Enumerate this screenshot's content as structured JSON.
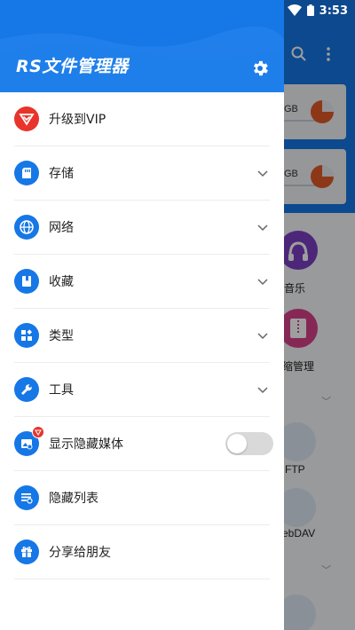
{
  "status_bar": {
    "time": "3:53"
  },
  "drawer": {
    "title": "RS文件管理器",
    "items": [
      {
        "label": "升级到VIP",
        "icon": "vip-crown-icon",
        "has_chevron": false
      },
      {
        "label": "存储",
        "icon": "sd-card-icon",
        "has_chevron": true
      },
      {
        "label": "网络",
        "icon": "globe-icon",
        "has_chevron": true
      },
      {
        "label": "收藏",
        "icon": "bookmark-icon",
        "has_chevron": true
      },
      {
        "label": "类型",
        "icon": "category-icon",
        "has_chevron": true
      },
      {
        "label": "工具",
        "icon": "wrench-icon",
        "has_chevron": true
      },
      {
        "label": "显示隐藏媒体",
        "icon": "hidden-media-icon",
        "has_badge": true,
        "toggle_on": false
      },
      {
        "label": "隐藏列表",
        "icon": "hidden-list-icon",
        "has_chevron": false
      },
      {
        "label": "分享给朋友",
        "icon": "gift-icon",
        "has_chevron": false
      }
    ]
  },
  "background": {
    "storage_cards": [
      {
        "size_text": "GB"
      },
      {
        "size_text": "GB"
      }
    ],
    "categories": [
      {
        "label": "音乐"
      },
      {
        "label": "缩管理"
      }
    ],
    "network": [
      {
        "label": "FTP"
      },
      {
        "label": "ebDAV"
      }
    ]
  },
  "colors": {
    "primary": "#1677e6",
    "vip_red": "#e8342b",
    "music_purple": "#7b3fc4",
    "compress_pink": "#d9418a",
    "pie_orange": "#e25b28"
  }
}
